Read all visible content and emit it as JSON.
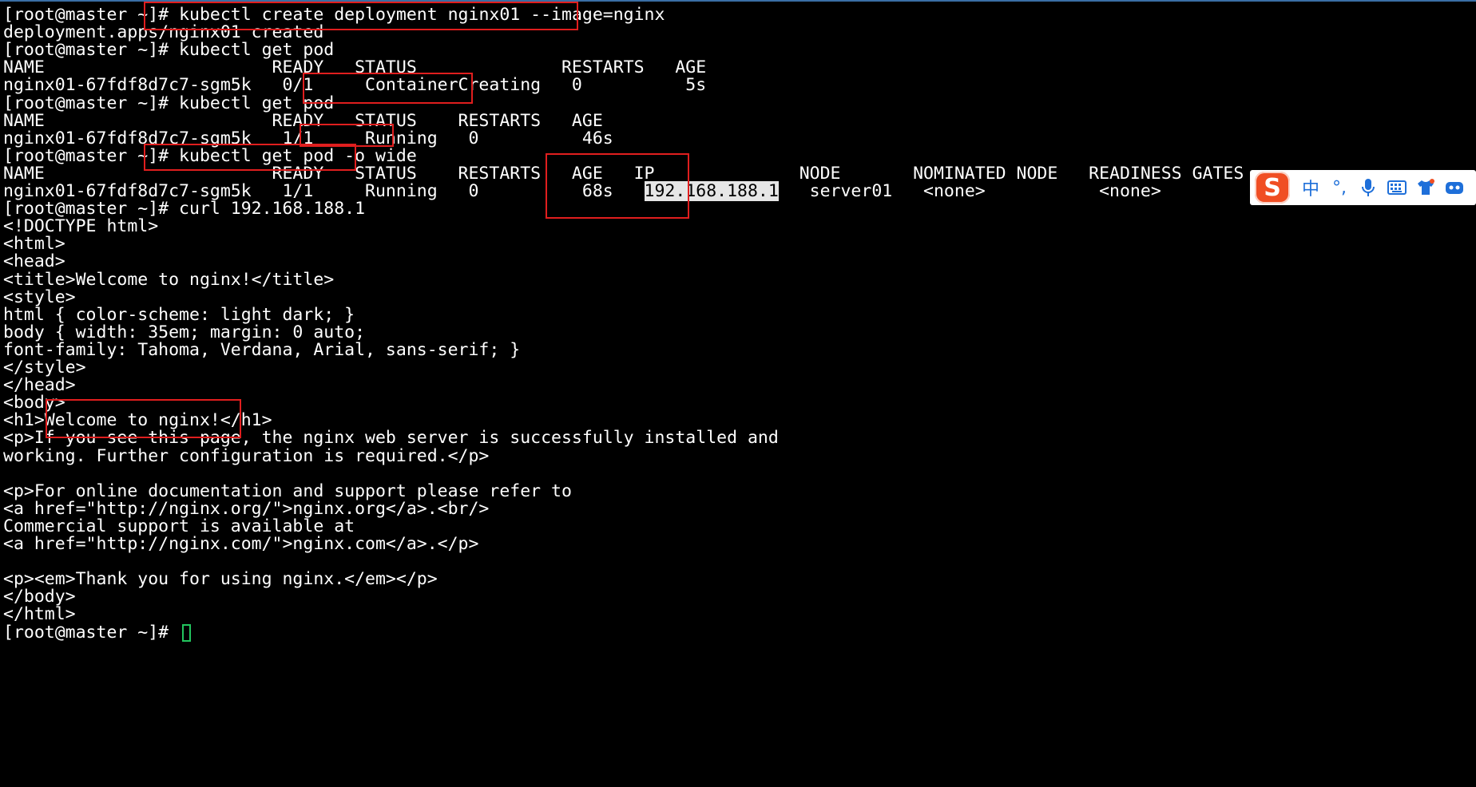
{
  "terminal": {
    "lines": [
      {
        "segments": [
          {
            "text": "[root@master ~]# "
          },
          {
            "text": "kubectl create deployment nginx01 --image=nginx"
          }
        ]
      },
      {
        "segments": [
          {
            "text": "deployment.apps/nginx01 created"
          }
        ]
      },
      {
        "segments": [
          {
            "text": "[root@master ~]# kubectl get pod"
          }
        ]
      },
      {
        "segments": [
          {
            "text": "NAME                      READY   STATUS              RESTARTS   AGE"
          }
        ]
      },
      {
        "segments": [
          {
            "text": "nginx01-67fdf8d7c7-sgm5k   0/1     ContainerCreating   0          5s"
          }
        ]
      },
      {
        "segments": [
          {
            "text": "[root@master ~]# kubectl get pod"
          }
        ]
      },
      {
        "segments": [
          {
            "text": "NAME                      READY   STATUS    RESTARTS   AGE"
          }
        ]
      },
      {
        "segments": [
          {
            "text": "nginx01-67fdf8d7c7-sgm5k   1/1     Running   0          46s"
          }
        ]
      },
      {
        "segments": [
          {
            "text": "[root@master ~]# kubectl get pod -o wide"
          }
        ]
      },
      {
        "segments": [
          {
            "text": "NAME                      READY   STATUS    RESTARTS   AGE   IP              NODE       NOMINATED NODE   READINESS GATES"
          }
        ]
      },
      {
        "segments": [
          {
            "text": "nginx01-67fdf8d7c7-sgm5k   1/1     Running   0          68s   "
          },
          {
            "text": "192.168.188.1",
            "selected": true
          },
          {
            "text": "   server01   <none>           <none>"
          }
        ]
      },
      {
        "segments": [
          {
            "text": "[root@master ~]# curl 192.168.188.1"
          }
        ]
      },
      {
        "segments": [
          {
            "text": "<!DOCTYPE html>"
          }
        ]
      },
      {
        "segments": [
          {
            "text": "<html>"
          }
        ]
      },
      {
        "segments": [
          {
            "text": "<head>"
          }
        ]
      },
      {
        "segments": [
          {
            "text": "<title>Welcome to nginx!</title>"
          }
        ]
      },
      {
        "segments": [
          {
            "text": "<style>"
          }
        ]
      },
      {
        "segments": [
          {
            "text": "html { color-scheme: light dark; }"
          }
        ]
      },
      {
        "segments": [
          {
            "text": "body { width: 35em; margin: 0 auto;"
          }
        ]
      },
      {
        "segments": [
          {
            "text": "font-family: Tahoma, Verdana, Arial, sans-serif; }"
          }
        ]
      },
      {
        "segments": [
          {
            "text": "</style>"
          }
        ]
      },
      {
        "segments": [
          {
            "text": "</head>"
          }
        ]
      },
      {
        "segments": [
          {
            "text": "<body>"
          }
        ]
      },
      {
        "segments": [
          {
            "text": "<h1>Welcome to nginx!</h1>"
          }
        ]
      },
      {
        "segments": [
          {
            "text": "<p>If you see this page, the nginx web server is successfully installed and"
          }
        ]
      },
      {
        "segments": [
          {
            "text": "working. Further configuration is required.</p>"
          }
        ]
      },
      {
        "segments": [
          {
            "text": ""
          }
        ]
      },
      {
        "segments": [
          {
            "text": "<p>For online documentation and support please refer to"
          }
        ]
      },
      {
        "segments": [
          {
            "text": "<a href=\"http://nginx.org/\">nginx.org</a>.<br/>"
          }
        ]
      },
      {
        "segments": [
          {
            "text": "Commercial support is available at"
          }
        ]
      },
      {
        "segments": [
          {
            "text": "<a href=\"http://nginx.com/\">nginx.com</a>.</p>"
          }
        ]
      },
      {
        "segments": [
          {
            "text": ""
          }
        ]
      },
      {
        "segments": [
          {
            "text": "<p><em>Thank you for using nginx.</em></p>"
          }
        ]
      },
      {
        "segments": [
          {
            "text": "</body>"
          }
        ]
      },
      {
        "segments": [
          {
            "text": "</html>"
          }
        ]
      },
      {
        "segments": [
          {
            "text": "[root@master ~]# "
          }
        ],
        "cursor": true
      }
    ]
  },
  "colors": {
    "background": "#000000",
    "foreground": "#ffffff",
    "highlight_box": "#e01e1e",
    "cursor": "#22c55e",
    "selection": "#e6e6e6"
  },
  "ime_toolbar": {
    "logo": "S",
    "mode_label": "中",
    "punctuation_label": "°,",
    "icons": [
      "microphone-icon",
      "keyboard-icon",
      "skin-shirt-icon",
      "toolbox-icon"
    ]
  }
}
